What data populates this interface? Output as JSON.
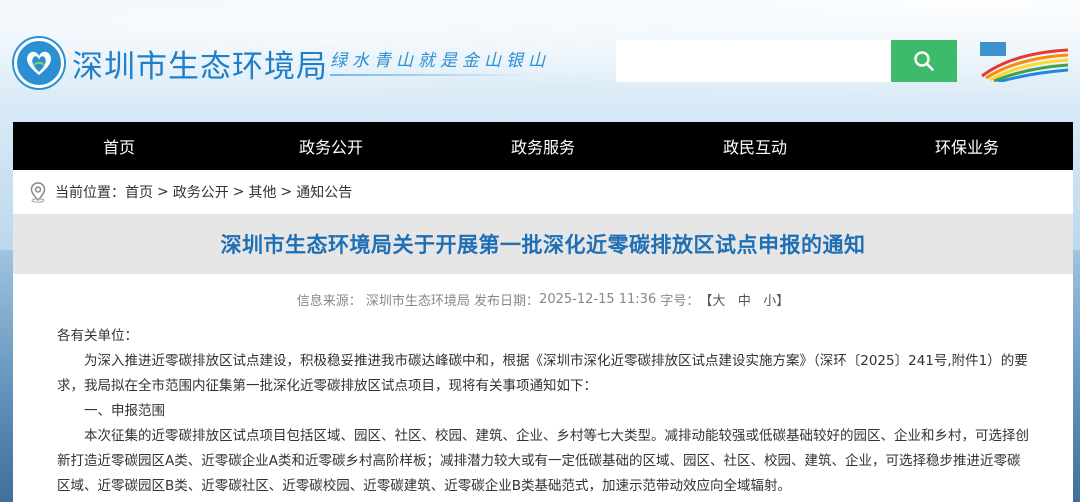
{
  "header": {
    "site_name": "深圳市生态环境局",
    "slogan": "绿水青山就是金山银山",
    "search_placeholder": "",
    "colors": {
      "brand": "#1f7fc7",
      "search_button": "#3dbb6a",
      "nav_bg": "#000000",
      "title": "#1f6fb4"
    }
  },
  "nav": {
    "items": [
      "首页",
      "政务公开",
      "政务服务",
      "政民互动",
      "环保业务"
    ]
  },
  "breadcrumb": {
    "label": "当前位置：",
    "items": [
      "首页",
      "政务公开",
      "其他",
      "通知公告"
    ],
    "separator": ">"
  },
  "article": {
    "title": "深圳市生态环境局关于开展第一批深化近零碳排放区试点申报的通知",
    "meta": {
      "source_label": "信息来源：",
      "source": "深圳市生态环境局",
      "date_label": "发布日期：",
      "date": "2025-12-15 11:36",
      "fontsize_label": "字号：",
      "bracket_open": "【",
      "size_large": "大",
      "size_medium": "中",
      "size_small": "小",
      "bracket_close": "】"
    },
    "salutation": "各有关单位：",
    "para1": "为深入推进近零碳排放区试点建设，积极稳妥推进我市碳达峰碳中和，根据《深圳市深化近零碳排放区试点建设实施方案》（深环〔2025〕241号,附件1）的要求，我局拟在全市范围内征集第一批深化近零碳排放区试点项目，现将有关事项通知如下：",
    "section1": "一、申报范围",
    "para2": "本次征集的近零碳排放区试点项目包括区域、园区、社区、校园、建筑、企业、乡村等七大类型。减排动能较强或低碳基础较好的园区、企业和乡村，可选择创新打造近零碳园区A类、近零碳企业A类和近零碳乡村高阶样板；减排潜力较大或有一定低碳基础的区域、园区、社区、校园、建筑、企业，可选择稳步推进近零碳区域、近零碳园区B类、近零碳社区、近零碳校园、近零碳建筑、近零碳企业B类基础范式，加速示范带动效应向全域辐射。"
  }
}
